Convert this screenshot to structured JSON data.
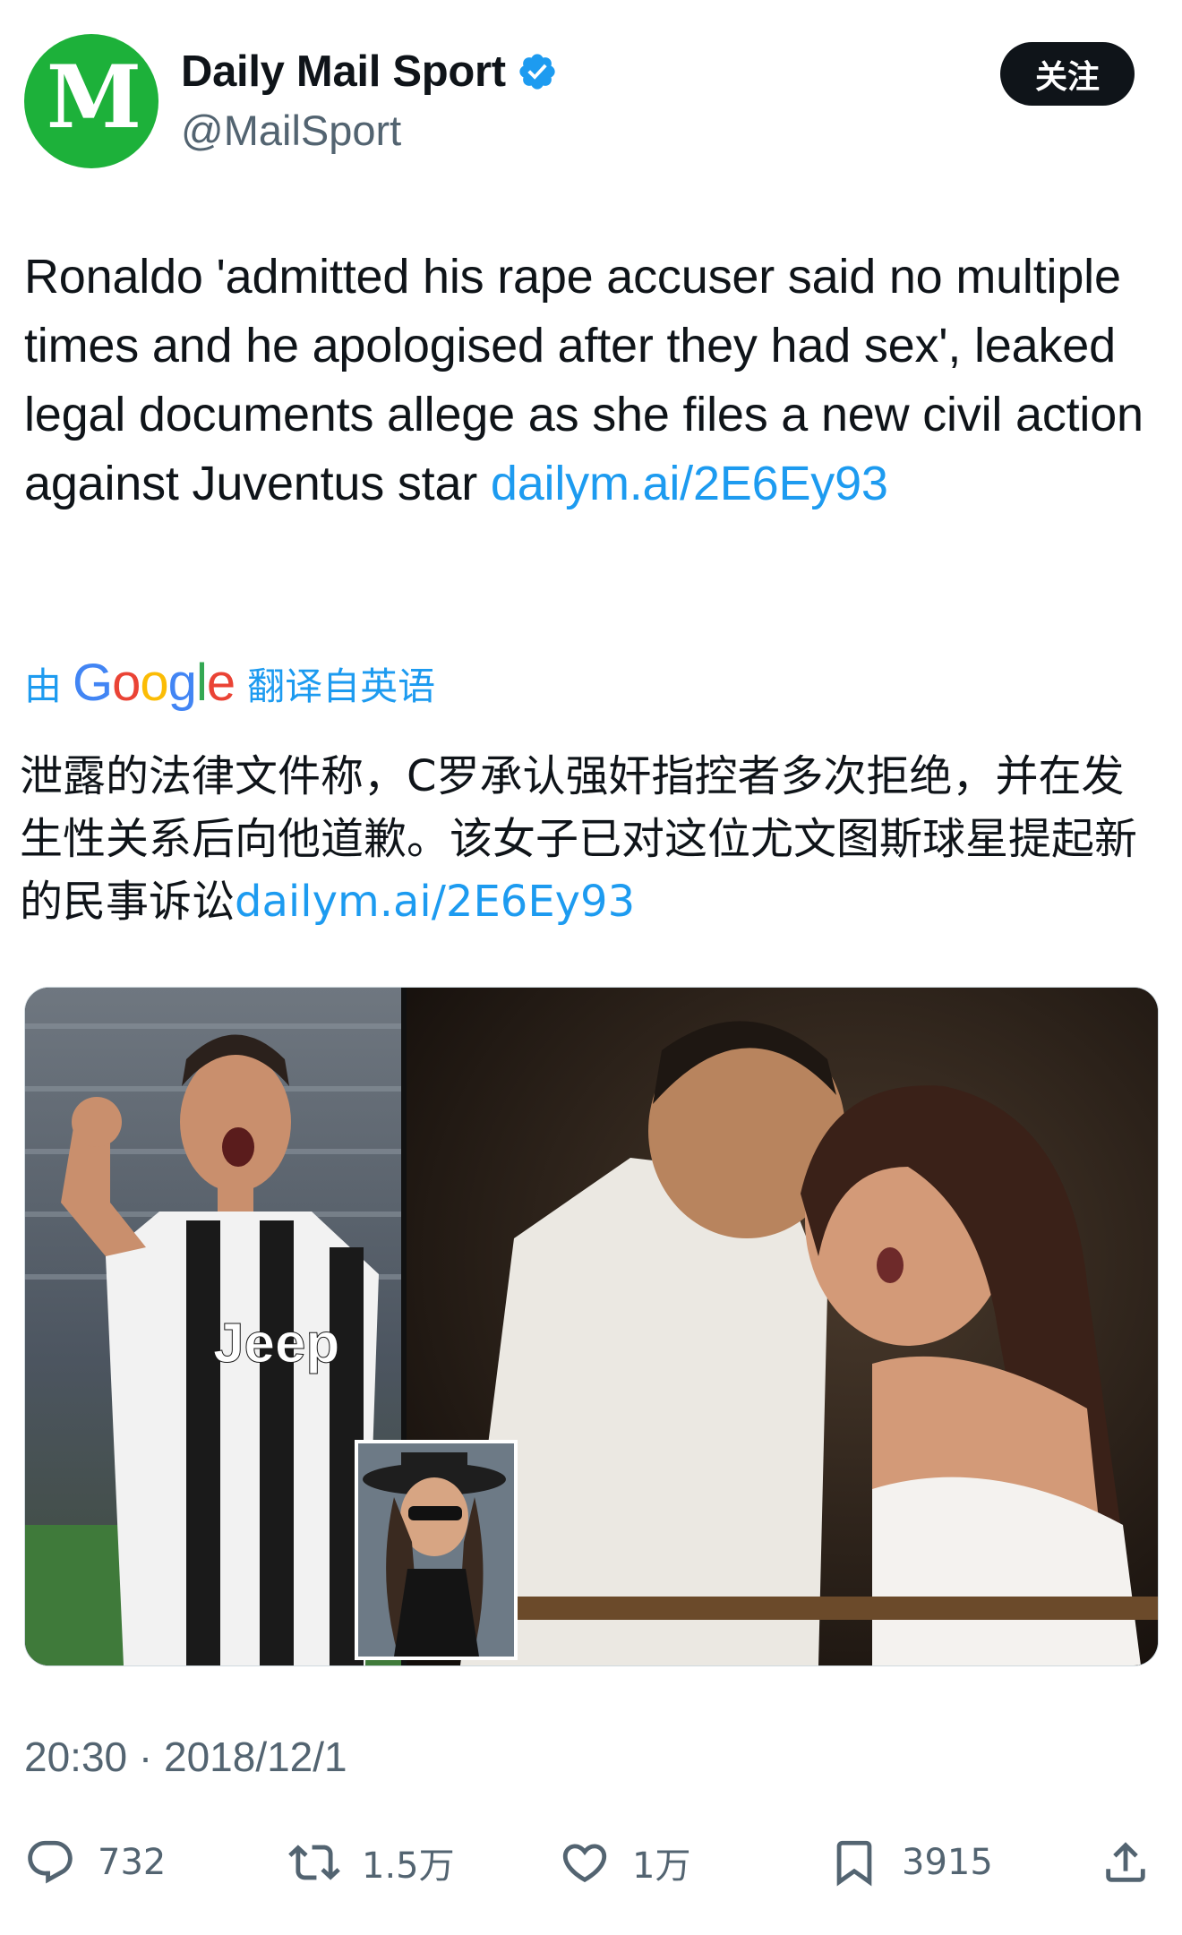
{
  "header": {
    "avatar_letter": "M",
    "display_name": "Daily Mail Sport",
    "handle": "@MailSport",
    "follow_label": "关注",
    "verified_color": "#1d9bf0"
  },
  "tweet": {
    "text": "Ronaldo 'admitted his rape accuser said no multiple times and he apologised after they had sex', leaked legal documents allege as she files a new civil action against Juventus star ",
    "link": "dailym.ai/2E6Ey93"
  },
  "translation": {
    "prefix": "由",
    "provider": "Google",
    "suffix": "翻译自英语",
    "text": "泄露的法律文件称，C罗承认强奸指控者多次拒绝，并在发生性关系后向他道歉。该女子已对这位尤文图斯球星提起新的民事诉讼",
    "link": "dailym.ai/2E6Ey93"
  },
  "media": {
    "shirt_text": "Jeep"
  },
  "timestamp": "20:30 · 2018/12/1",
  "actions": {
    "reply_count": "732",
    "retweet_count": "1.5万",
    "like_count": "1万",
    "bookmark_count": "3915"
  },
  "colors": {
    "accent": "#1d9bf0",
    "secondary_text": "#536471",
    "avatar_bg": "#1db13a"
  }
}
